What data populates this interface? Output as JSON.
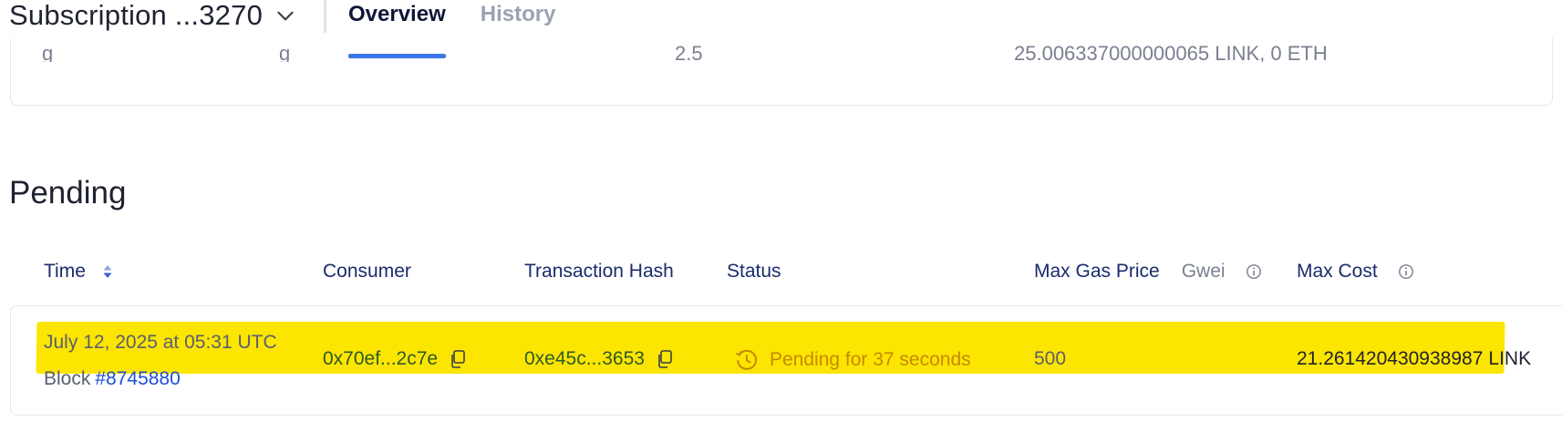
{
  "header": {
    "subscription_label": "Subscription ...3270",
    "tabs": [
      {
        "label": "Overview",
        "active": true
      },
      {
        "label": "History",
        "active": false
      }
    ]
  },
  "top_card": {
    "cut_values": [
      "g",
      "g",
      "2.5",
      "25.006337000000065 LINK, 0 ETH"
    ]
  },
  "pending": {
    "title": "Pending",
    "columns": {
      "time": "Time",
      "consumer": "Consumer",
      "tx_hash": "Transaction Hash",
      "status": "Status",
      "max_gas_price": "Max Gas Price",
      "gas_unit": "Gwei",
      "max_cost": "Max Cost"
    },
    "rows": [
      {
        "time": "July 12, 2025 at 05:31 UTC",
        "block_label": "Block",
        "block_number": "#8745880",
        "consumer": "0x70ef...2c7e",
        "tx_hash": "0xe45c...3653",
        "status": "Pending for 37 seconds",
        "max_gas_price": "500",
        "max_cost": "21.261420430938987",
        "max_cost_unit": "LINK"
      }
    ]
  },
  "colors": {
    "highlight": "#fce500",
    "accent": "#3b78e7",
    "link": "#1d4ed8",
    "status_pending": "#c58a00"
  }
}
